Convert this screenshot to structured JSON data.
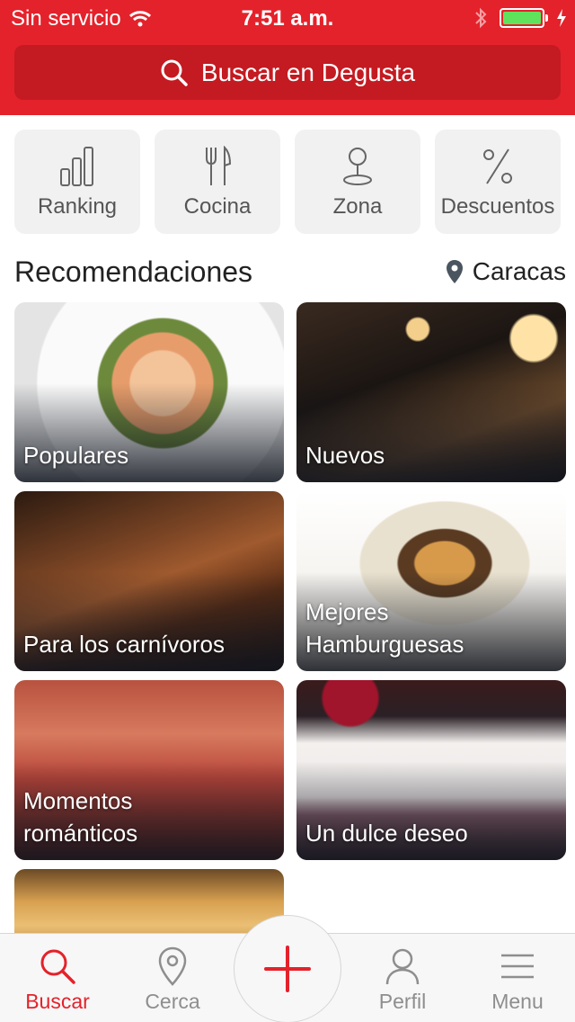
{
  "status_bar": {
    "carrier": "Sin servicio",
    "time": "7:51 a.m.",
    "battery_level": 1.0,
    "icons": [
      "wifi-icon",
      "bluetooth-icon",
      "battery-icon",
      "charging-icon"
    ]
  },
  "search": {
    "label": "Buscar en Degusta",
    "icon": "search-icon"
  },
  "categories": [
    {
      "label": "Ranking",
      "icon": "bar-chart-icon"
    },
    {
      "label": "Cocina",
      "icon": "fork-knife-icon"
    },
    {
      "label": "Zona",
      "icon": "map-pin-icon"
    },
    {
      "label": "Descuentos",
      "icon": "percent-icon"
    }
  ],
  "recommendations": {
    "title": "Recomendaciones",
    "location": "Caracas",
    "location_icon": "location-pin-icon",
    "cards": [
      {
        "label": "Populares"
      },
      {
        "label": "Nuevos"
      },
      {
        "label": "Para los carnívoros"
      },
      {
        "label": "Mejores Hamburguesas"
      },
      {
        "label": "Momentos románticos"
      },
      {
        "label": "Un dulce deseo"
      }
    ]
  },
  "tabbar": {
    "items": [
      {
        "label": "Buscar",
        "icon": "search-icon",
        "active": true
      },
      {
        "label": "Cerca",
        "icon": "map-pin-icon",
        "active": false
      },
      {
        "label": "Perfil",
        "icon": "user-icon",
        "active": false
      },
      {
        "label": "Menu",
        "icon": "hamburger-menu-icon",
        "active": false
      }
    ],
    "center_button_icon": "plus-icon"
  },
  "colors": {
    "brand_red": "#e4222b",
    "search_bar_red": "#c41a21",
    "tile_bg": "#f1f1f1",
    "tab_inactive": "#8e8e8e"
  }
}
